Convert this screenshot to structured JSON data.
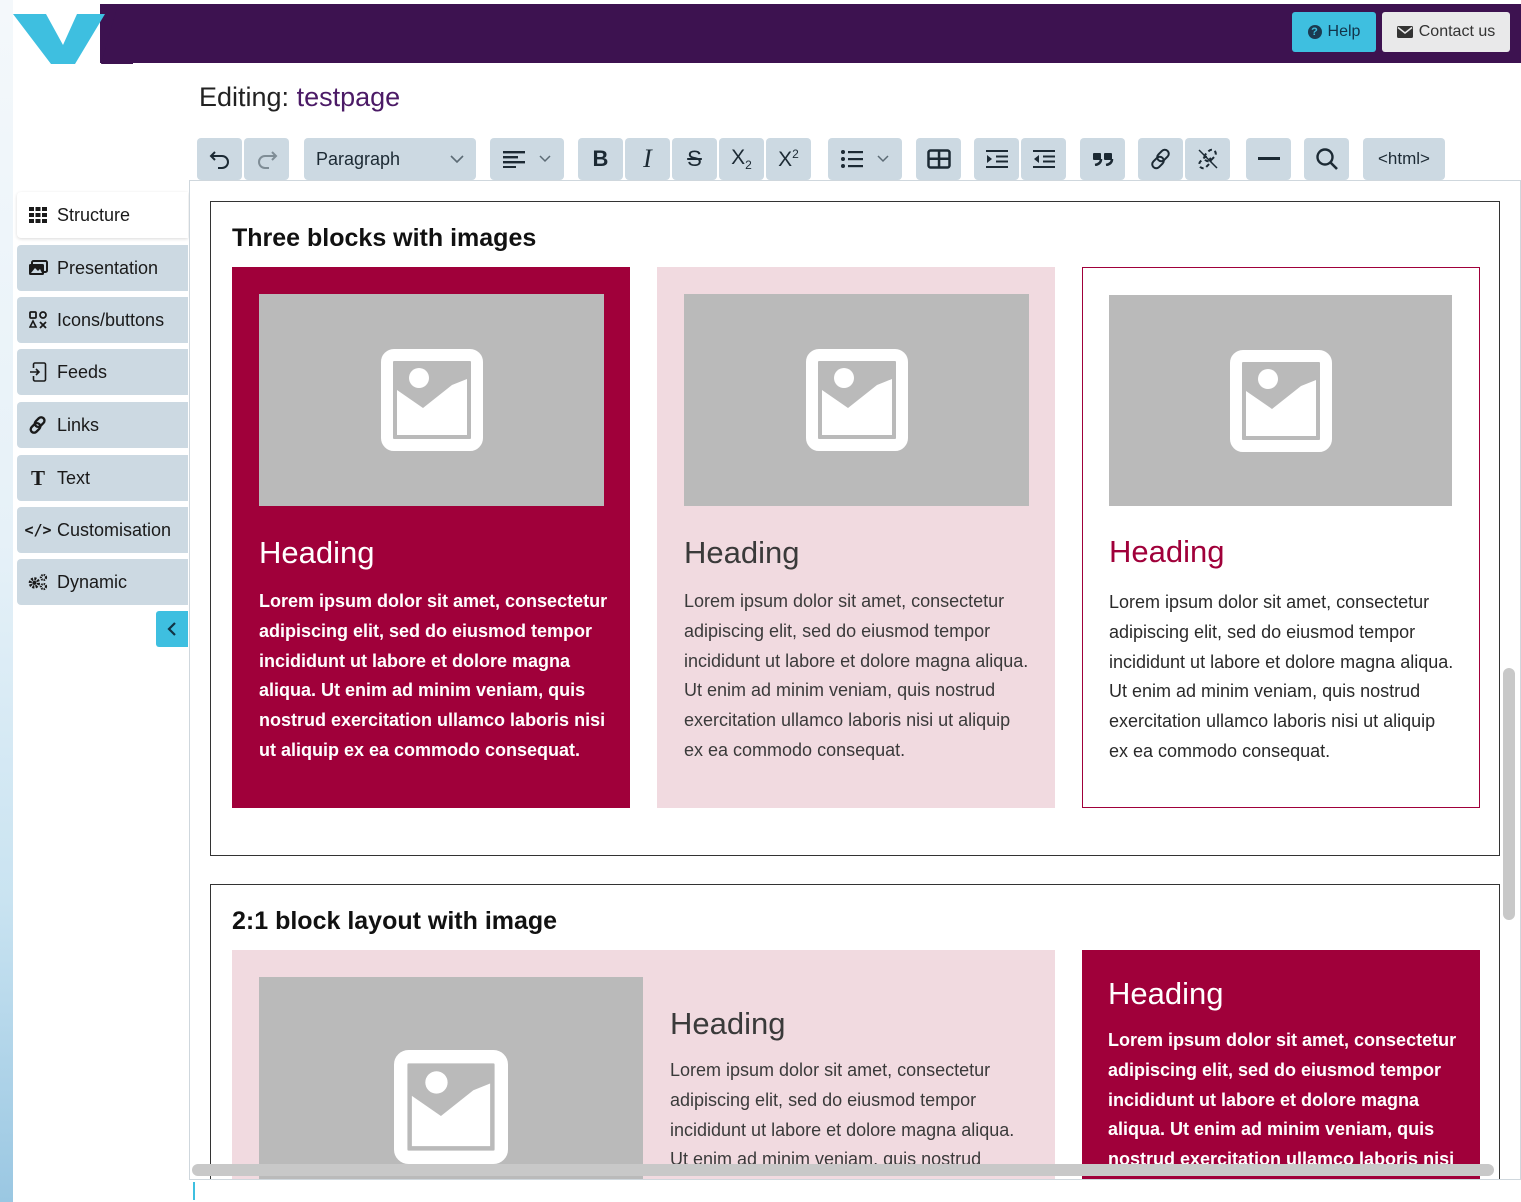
{
  "header": {
    "help_label": "Help",
    "contact_label": "Contact us",
    "bar_color": "#3d1250",
    "accent_color": "#3ebfe0"
  },
  "page": {
    "title_prefix": "Editing:",
    "page_name": "testpage"
  },
  "toolbar": {
    "format_select": "Paragraph",
    "html_label": "<html>",
    "buttons": [
      "undo-icon",
      "redo-icon",
      "align-left-icon",
      "bold-icon",
      "italic-icon",
      "strikethrough-icon",
      "subscript-icon",
      "superscript-icon",
      "bullet-list-icon",
      "table-icon",
      "indent-icon",
      "outdent-icon",
      "blockquote-icon",
      "link-icon",
      "unlink-icon",
      "horizontal-rule-icon",
      "search-icon"
    ]
  },
  "sidebar": {
    "items": [
      {
        "label": "Structure",
        "icon": "grid-icon"
      },
      {
        "label": "Presentation",
        "icon": "presentation-icon"
      },
      {
        "label": "Icons/buttons",
        "icon": "icons-buttons-icon"
      },
      {
        "label": "Feeds",
        "icon": "feed-icon"
      },
      {
        "label": "Links",
        "icon": "link-icon"
      },
      {
        "label": "Text",
        "icon": "text-icon"
      },
      {
        "label": "Customisation",
        "icon": "code-icon"
      },
      {
        "label": "Dynamic",
        "icon": "cogs-icon"
      }
    ],
    "active": "Structure"
  },
  "editor": {
    "section1": {
      "title": "Three blocks with images",
      "cards": [
        {
          "style": "crimson",
          "heading": "Heading",
          "body": "Lorem ipsum dolor sit amet, consectetur adipiscing elit, sed do eiusmod tempor incididunt ut labore et dolore magna aliqua. Ut enim ad minim veniam, quis nostrud exercitation ullamco laboris nisi ut aliquip ex ea commodo consequat."
        },
        {
          "style": "pink",
          "heading": "Heading",
          "body": "Lorem ipsum dolor sit amet, consectetur adipiscing elit, sed do eiusmod tempor incididunt ut labore et dolore magna aliqua. Ut enim ad minim veniam, quis nostrud exercitation ullamco laboris nisi ut aliquip ex ea commodo consequat."
        },
        {
          "style": "outline",
          "heading": "Heading",
          "body": "Lorem ipsum dolor sit amet, consectetur adipiscing elit, sed do eiusmod tempor incididunt ut labore et dolore magna aliqua. Ut enim ad minim veniam, quis nostrud exercitation ullamco laboris nisi ut aliquip ex ea commodo consequat."
        }
      ]
    },
    "section2": {
      "title": "2:1 block layout with image",
      "left": {
        "heading": "Heading",
        "body": "Lorem ipsum dolor sit amet, consectetur adipiscing elit, sed do eiusmod tempor incididunt ut labore et dolore magna aliqua. Ut enim ad minim veniam, quis nostrud exercitation ullamco laboris nisi ut aliquip ex ea commodo consequat."
      },
      "right": {
        "heading": "Heading",
        "body": "Lorem ipsum dolor sit amet, consectetur adipiscing elit, sed do eiusmod tempor incididunt ut labore et dolore magna aliqua. Ut enim ad minim veniam, quis nostrud exercitation ullamco laboris nisi ut aliquip ex ea commodo consequat."
      }
    },
    "colors": {
      "crimson": "#a0003a",
      "pink": "#f1dae0",
      "placeholder": "#bababa"
    }
  }
}
